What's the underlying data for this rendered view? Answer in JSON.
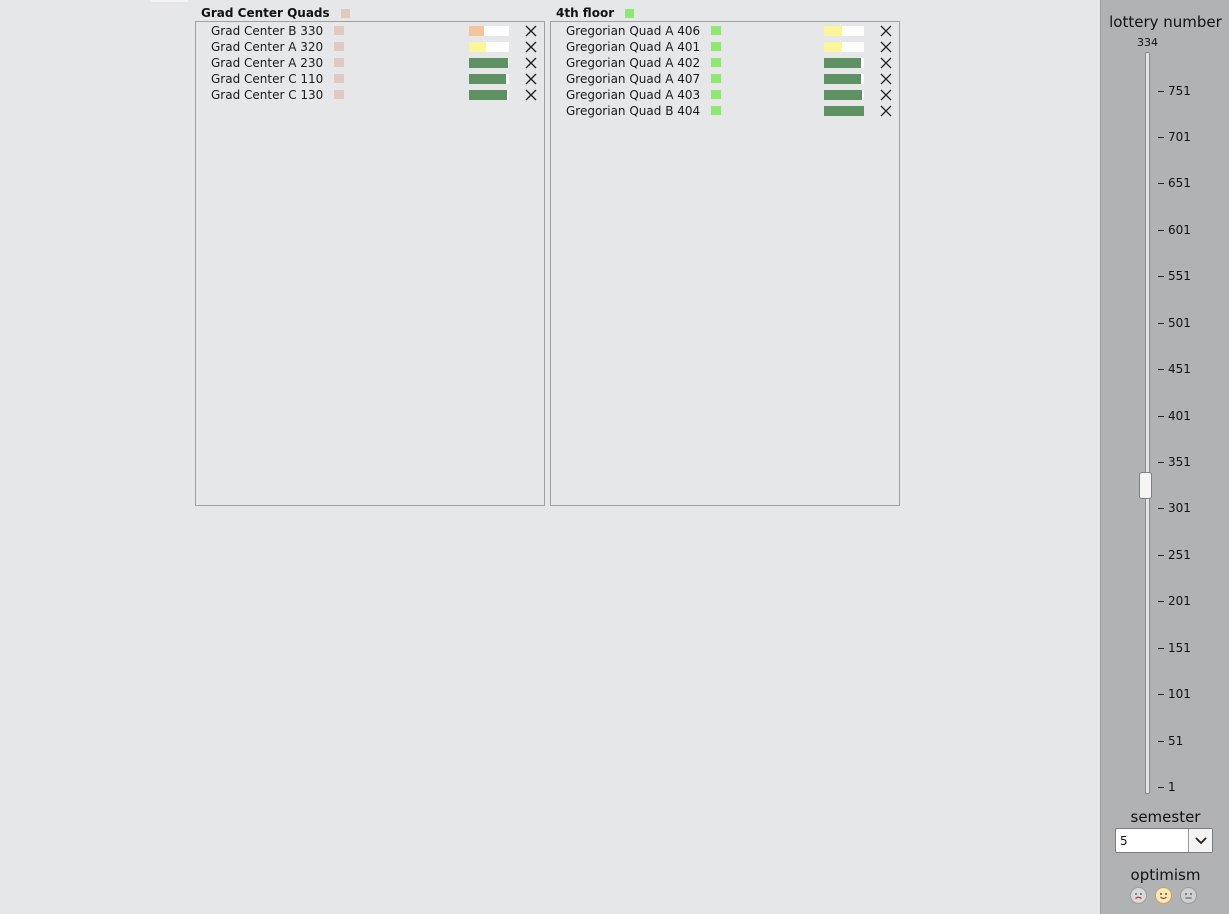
{
  "groups": [
    {
      "title": "Grad Center Quads",
      "color": "#e2c9bd",
      "rooms": [
        {
          "name": "Grad Center B 330",
          "dot": "#e2c9bd",
          "fill": 0.38,
          "fill_color": "#f6c49a"
        },
        {
          "name": "Grad Center A 320",
          "dot": "#e2c9bd",
          "fill": 0.42,
          "fill_color": "#fbf69a"
        },
        {
          "name": "Grad Center A 230",
          "dot": "#e2c9bd",
          "fill": 0.98,
          "fill_color": "#5f9263"
        },
        {
          "name": "Grad Center C 110",
          "dot": "#e2c9bd",
          "fill": 0.92,
          "fill_color": "#5f9263"
        },
        {
          "name": "Grad Center C 130",
          "dot": "#e2c9bd",
          "fill": 0.94,
          "fill_color": "#5f9263"
        }
      ]
    },
    {
      "title": "4th floor",
      "color": "#8ee872",
      "rooms": [
        {
          "name": "Gregorian Quad A 406",
          "dot": "#8ee872",
          "fill": 0.46,
          "fill_color": "#fbf69a"
        },
        {
          "name": "Gregorian Quad A 401",
          "dot": "#8ee872",
          "fill": 0.46,
          "fill_color": "#fbf69a"
        },
        {
          "name": "Gregorian Quad A 402",
          "dot": "#8ee872",
          "fill": 0.93,
          "fill_color": "#5f9263"
        },
        {
          "name": "Gregorian Quad A 407",
          "dot": "#8ee872",
          "fill": 0.93,
          "fill_color": "#5f9263"
        },
        {
          "name": "Gregorian Quad A 403",
          "dot": "#8ee872",
          "fill": 0.96,
          "fill_color": "#5f9263"
        },
        {
          "name": "Gregorian Quad B 404",
          "dot": "#8ee872",
          "fill": 0.99,
          "fill_color": "#5f9263"
        }
      ]
    }
  ],
  "sidebar": {
    "lottery_title": "lottery number",
    "lottery_value": "334",
    "lottery_min": 1,
    "lottery_max": 800,
    "ticks": [
      "751",
      "701",
      "651",
      "601",
      "551",
      "501",
      "451",
      "401",
      "351",
      "301",
      "251",
      "201",
      "151",
      "101",
      "51",
      "1"
    ],
    "semester_title": "semester",
    "semester_value": "5",
    "optimism_title": "optimism",
    "optimism_faces": [
      {
        "icon": "sad-face-icon",
        "color": "#d9d9d9"
      },
      {
        "icon": "happy-face-icon",
        "color": "#fde8b9"
      },
      {
        "icon": "neutral-face-icon",
        "color": "#d0d0d2"
      }
    ]
  }
}
